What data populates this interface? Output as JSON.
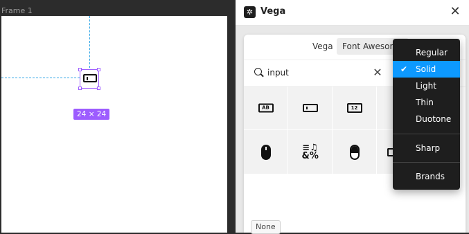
{
  "canvas": {
    "frame_label": "Frame 1",
    "size_badge": "24 × 24"
  },
  "window": {
    "title": "Vega",
    "app_icon": "vega-logo-icon",
    "close_glyph": "✕"
  },
  "tabs": [
    {
      "label": "Vega"
    },
    {
      "label": "Font Awesome"
    }
  ],
  "search": {
    "value": "input",
    "clear_glyph": "✕"
  },
  "icon_grid": [
    {
      "name": "input-text-icon",
      "glyph": "AB"
    },
    {
      "name": "text-input-icon",
      "glyph": ""
    },
    {
      "name": "input-numeric-icon",
      "glyph": "12"
    },
    {
      "name": "computer-mouse-icon",
      "glyph": ""
    },
    {
      "name": "symbols-icon",
      "glyph": "≡♫\n&%"
    },
    {
      "name": "computer-mouse-outline-icon",
      "glyph": ""
    },
    {
      "name": "partial-icon",
      "glyph": ""
    }
  ],
  "style_menu": {
    "items": [
      "Regular",
      "Solid",
      "Light",
      "Thin",
      "Duotone",
      "Sharp",
      "Brands"
    ],
    "selected": "Solid",
    "check_glyph": "✔"
  },
  "footer_button": "None",
  "colors": {
    "selection": "#9d5cff",
    "guide": "#2ea5e6",
    "menu_selected": "#0d99ff",
    "menu_bg": "#1e1e1e"
  }
}
